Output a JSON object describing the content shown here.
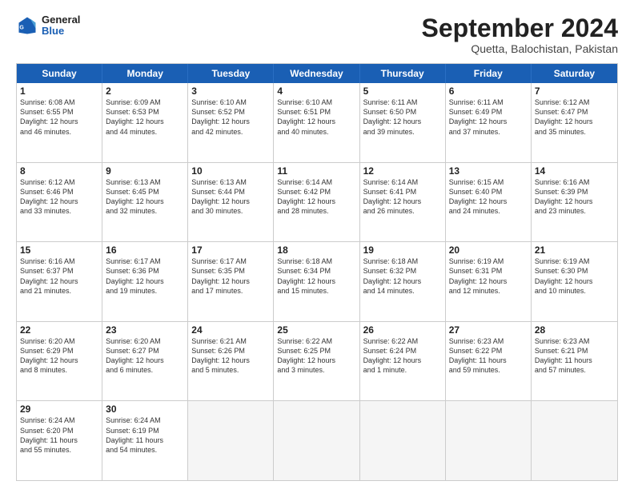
{
  "header": {
    "logo_general": "General",
    "logo_blue": "Blue",
    "month_title": "September 2024",
    "location": "Quetta, Balochistan, Pakistan"
  },
  "days_of_week": [
    "Sunday",
    "Monday",
    "Tuesday",
    "Wednesday",
    "Thursday",
    "Friday",
    "Saturday"
  ],
  "weeks": [
    [
      {
        "day": "1",
        "lines": [
          "Sunrise: 6:08 AM",
          "Sunset: 6:55 PM",
          "Daylight: 12 hours",
          "and 46 minutes."
        ]
      },
      {
        "day": "2",
        "lines": [
          "Sunrise: 6:09 AM",
          "Sunset: 6:53 PM",
          "Daylight: 12 hours",
          "and 44 minutes."
        ]
      },
      {
        "day": "3",
        "lines": [
          "Sunrise: 6:10 AM",
          "Sunset: 6:52 PM",
          "Daylight: 12 hours",
          "and 42 minutes."
        ]
      },
      {
        "day": "4",
        "lines": [
          "Sunrise: 6:10 AM",
          "Sunset: 6:51 PM",
          "Daylight: 12 hours",
          "and 40 minutes."
        ]
      },
      {
        "day": "5",
        "lines": [
          "Sunrise: 6:11 AM",
          "Sunset: 6:50 PM",
          "Daylight: 12 hours",
          "and 39 minutes."
        ]
      },
      {
        "day": "6",
        "lines": [
          "Sunrise: 6:11 AM",
          "Sunset: 6:49 PM",
          "Daylight: 12 hours",
          "and 37 minutes."
        ]
      },
      {
        "day": "7",
        "lines": [
          "Sunrise: 6:12 AM",
          "Sunset: 6:47 PM",
          "Daylight: 12 hours",
          "and 35 minutes."
        ]
      }
    ],
    [
      {
        "day": "8",
        "lines": [
          "Sunrise: 6:12 AM",
          "Sunset: 6:46 PM",
          "Daylight: 12 hours",
          "and 33 minutes."
        ]
      },
      {
        "day": "9",
        "lines": [
          "Sunrise: 6:13 AM",
          "Sunset: 6:45 PM",
          "Daylight: 12 hours",
          "and 32 minutes."
        ]
      },
      {
        "day": "10",
        "lines": [
          "Sunrise: 6:13 AM",
          "Sunset: 6:44 PM",
          "Daylight: 12 hours",
          "and 30 minutes."
        ]
      },
      {
        "day": "11",
        "lines": [
          "Sunrise: 6:14 AM",
          "Sunset: 6:42 PM",
          "Daylight: 12 hours",
          "and 28 minutes."
        ]
      },
      {
        "day": "12",
        "lines": [
          "Sunrise: 6:14 AM",
          "Sunset: 6:41 PM",
          "Daylight: 12 hours",
          "and 26 minutes."
        ]
      },
      {
        "day": "13",
        "lines": [
          "Sunrise: 6:15 AM",
          "Sunset: 6:40 PM",
          "Daylight: 12 hours",
          "and 24 minutes."
        ]
      },
      {
        "day": "14",
        "lines": [
          "Sunrise: 6:16 AM",
          "Sunset: 6:39 PM",
          "Daylight: 12 hours",
          "and 23 minutes."
        ]
      }
    ],
    [
      {
        "day": "15",
        "lines": [
          "Sunrise: 6:16 AM",
          "Sunset: 6:37 PM",
          "Daylight: 12 hours",
          "and 21 minutes."
        ]
      },
      {
        "day": "16",
        "lines": [
          "Sunrise: 6:17 AM",
          "Sunset: 6:36 PM",
          "Daylight: 12 hours",
          "and 19 minutes."
        ]
      },
      {
        "day": "17",
        "lines": [
          "Sunrise: 6:17 AM",
          "Sunset: 6:35 PM",
          "Daylight: 12 hours",
          "and 17 minutes."
        ]
      },
      {
        "day": "18",
        "lines": [
          "Sunrise: 6:18 AM",
          "Sunset: 6:34 PM",
          "Daylight: 12 hours",
          "and 15 minutes."
        ]
      },
      {
        "day": "19",
        "lines": [
          "Sunrise: 6:18 AM",
          "Sunset: 6:32 PM",
          "Daylight: 12 hours",
          "and 14 minutes."
        ]
      },
      {
        "day": "20",
        "lines": [
          "Sunrise: 6:19 AM",
          "Sunset: 6:31 PM",
          "Daylight: 12 hours",
          "and 12 minutes."
        ]
      },
      {
        "day": "21",
        "lines": [
          "Sunrise: 6:19 AM",
          "Sunset: 6:30 PM",
          "Daylight: 12 hours",
          "and 10 minutes."
        ]
      }
    ],
    [
      {
        "day": "22",
        "lines": [
          "Sunrise: 6:20 AM",
          "Sunset: 6:29 PM",
          "Daylight: 12 hours",
          "and 8 minutes."
        ]
      },
      {
        "day": "23",
        "lines": [
          "Sunrise: 6:20 AM",
          "Sunset: 6:27 PM",
          "Daylight: 12 hours",
          "and 6 minutes."
        ]
      },
      {
        "day": "24",
        "lines": [
          "Sunrise: 6:21 AM",
          "Sunset: 6:26 PM",
          "Daylight: 12 hours",
          "and 5 minutes."
        ]
      },
      {
        "day": "25",
        "lines": [
          "Sunrise: 6:22 AM",
          "Sunset: 6:25 PM",
          "Daylight: 12 hours",
          "and 3 minutes."
        ]
      },
      {
        "day": "26",
        "lines": [
          "Sunrise: 6:22 AM",
          "Sunset: 6:24 PM",
          "Daylight: 12 hours",
          "and 1 minute."
        ]
      },
      {
        "day": "27",
        "lines": [
          "Sunrise: 6:23 AM",
          "Sunset: 6:22 PM",
          "Daylight: 11 hours",
          "and 59 minutes."
        ]
      },
      {
        "day": "28",
        "lines": [
          "Sunrise: 6:23 AM",
          "Sunset: 6:21 PM",
          "Daylight: 11 hours",
          "and 57 minutes."
        ]
      }
    ],
    [
      {
        "day": "29",
        "lines": [
          "Sunrise: 6:24 AM",
          "Sunset: 6:20 PM",
          "Daylight: 11 hours",
          "and 55 minutes."
        ]
      },
      {
        "day": "30",
        "lines": [
          "Sunrise: 6:24 AM",
          "Sunset: 6:19 PM",
          "Daylight: 11 hours",
          "and 54 minutes."
        ]
      },
      {
        "day": "",
        "lines": []
      },
      {
        "day": "",
        "lines": []
      },
      {
        "day": "",
        "lines": []
      },
      {
        "day": "",
        "lines": []
      },
      {
        "day": "",
        "lines": []
      }
    ]
  ]
}
